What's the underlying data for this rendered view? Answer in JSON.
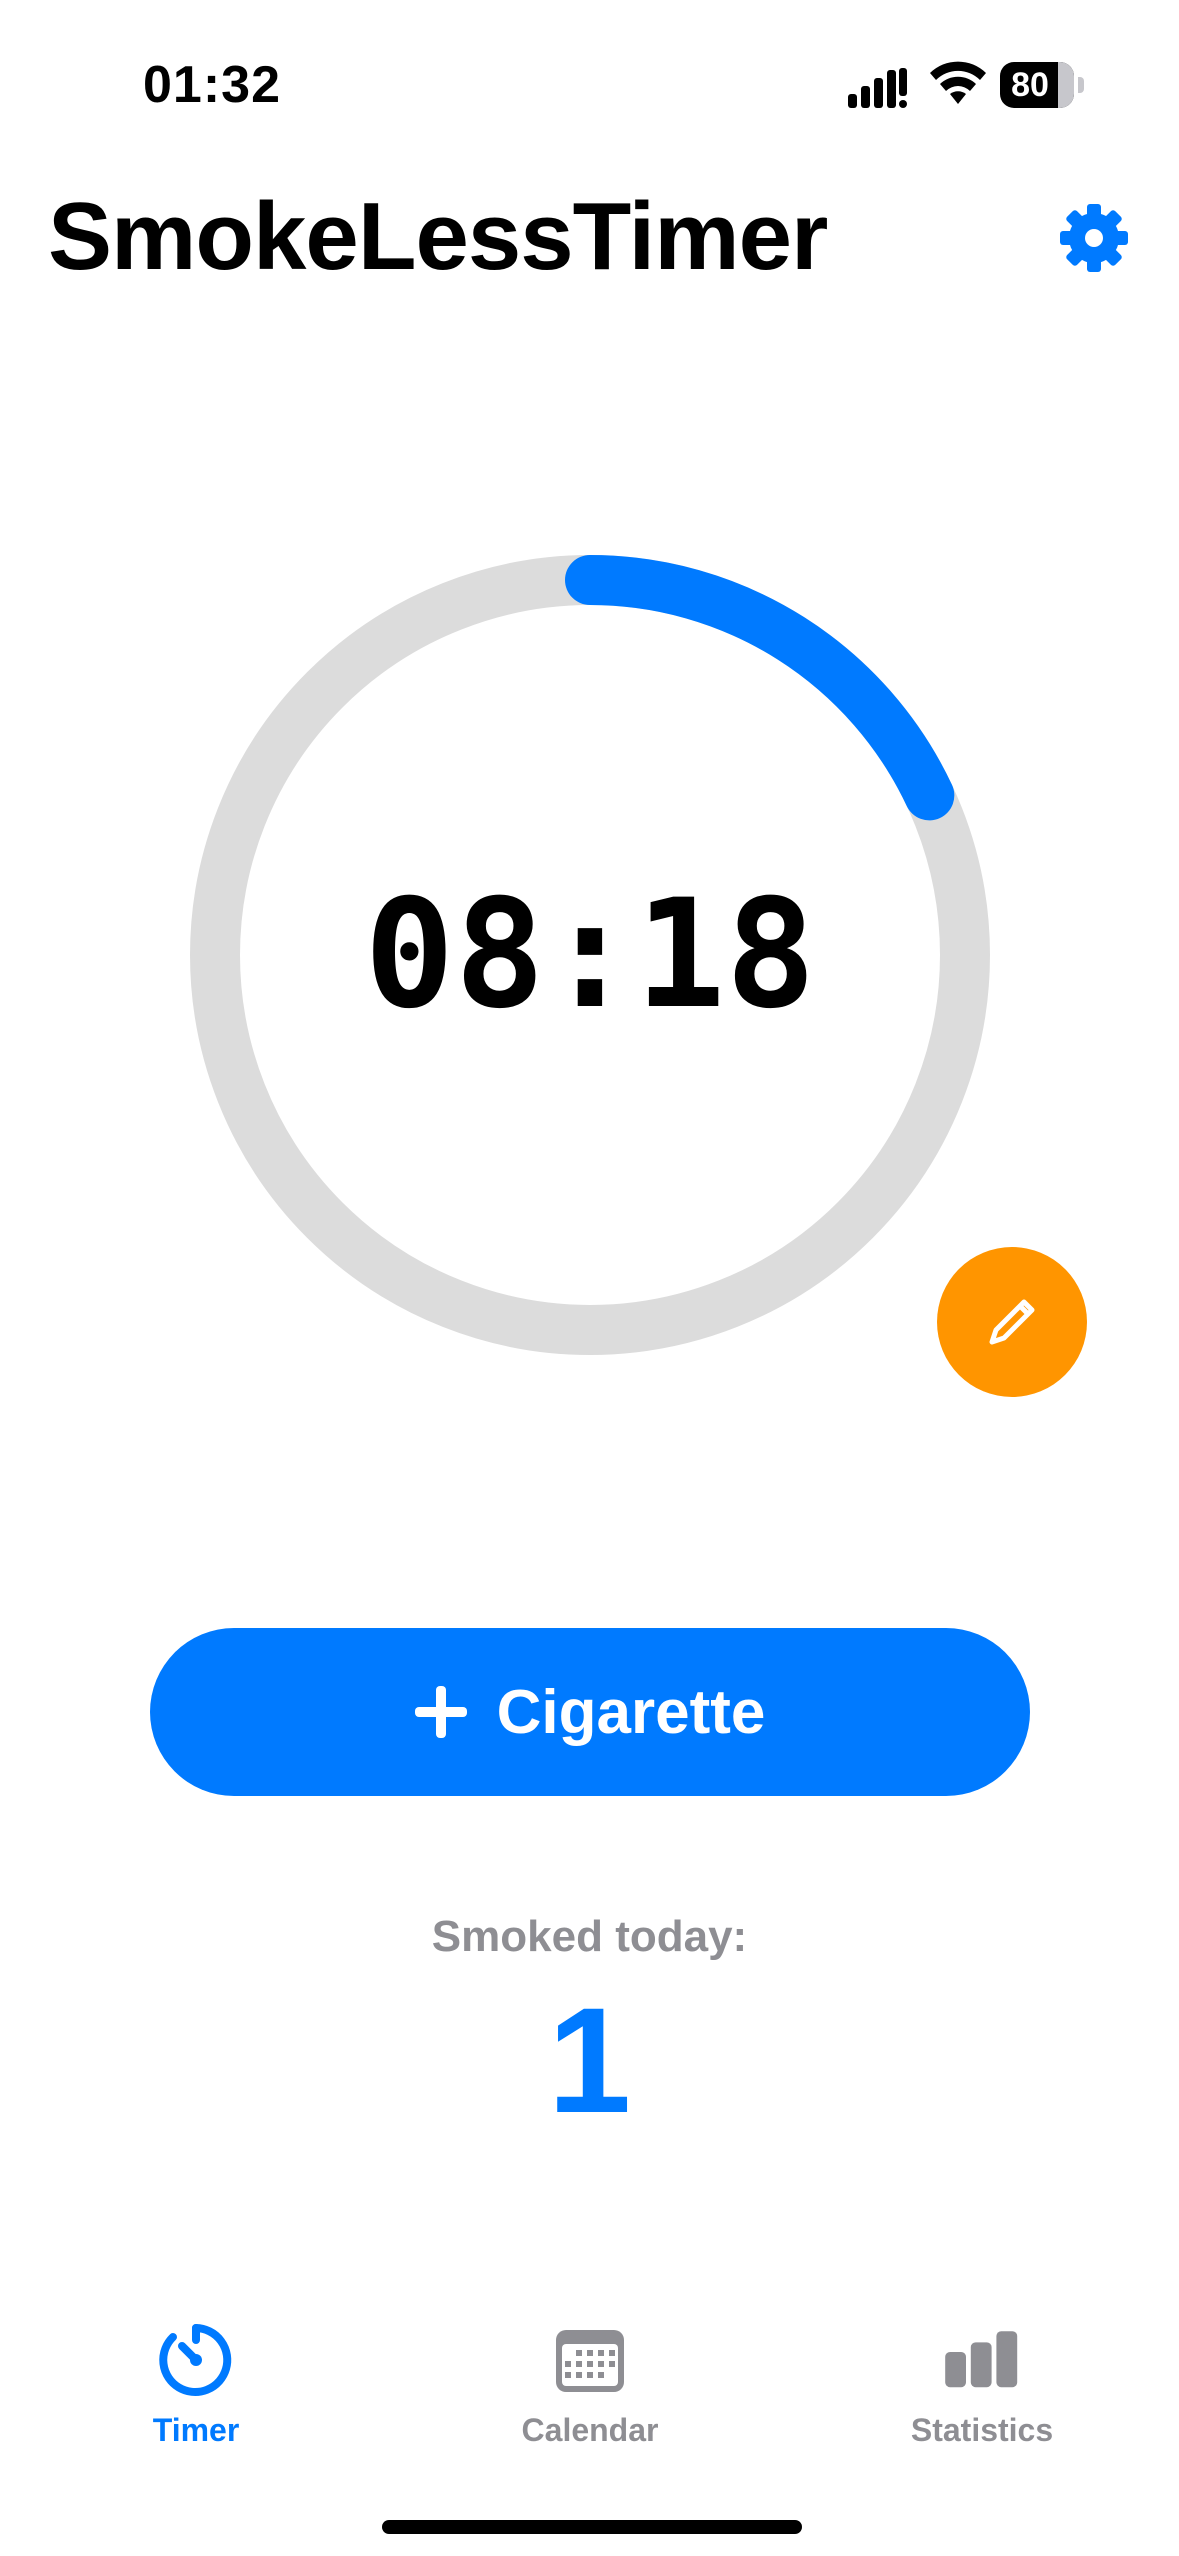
{
  "status_bar": {
    "time": "01:32",
    "battery_level": "80"
  },
  "header": {
    "title": "SmokeLessTimer",
    "settings_icon": "gear-icon"
  },
  "timer": {
    "display": "08:18",
    "progress": 0.18,
    "edit_icon": "pencil-icon"
  },
  "actions": {
    "add_label": "Cigarette",
    "add_icon": "plus-icon"
  },
  "stats": {
    "smoked_today_label": "Smoked today:",
    "smoked_today_count": "1"
  },
  "tabs": [
    {
      "label": "Timer",
      "icon": "timer-icon",
      "active": true
    },
    {
      "label": "Calendar",
      "icon": "calendar-icon",
      "active": false
    },
    {
      "label": "Statistics",
      "icon": "bar-chart-icon",
      "active": false
    }
  ],
  "colors": {
    "accent": "#007aff",
    "edit": "#ff9500",
    "track": "#dcdcdc",
    "inactive": "#8e8e93"
  }
}
